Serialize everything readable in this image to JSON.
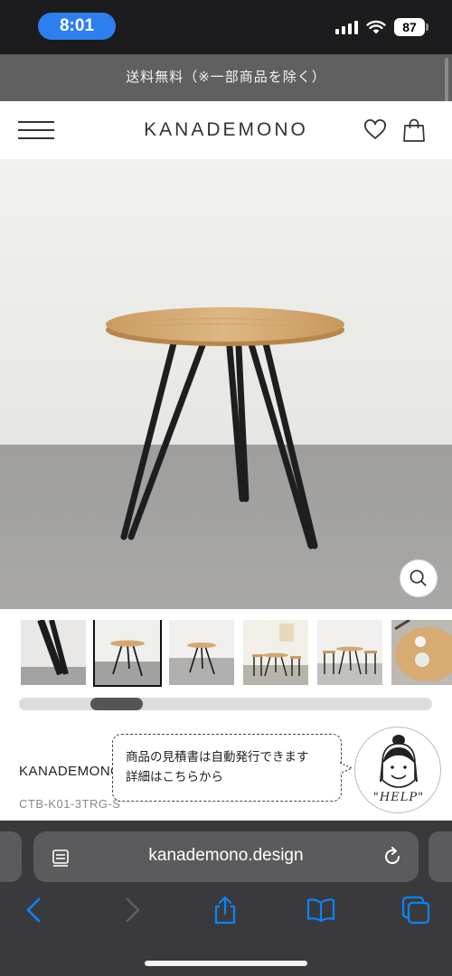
{
  "status_bar": {
    "time": "8:01",
    "battery": "87",
    "icons": [
      "signal-icon",
      "wifi-icon",
      "battery-icon"
    ]
  },
  "announcement": {
    "text": "送料無料（※一部商品を除く）"
  },
  "header": {
    "brand": "KANADEMONO",
    "icons": [
      "hamburger-menu-icon",
      "heart-icon",
      "shopping-bag-icon"
    ]
  },
  "product": {
    "brand": "KANADEMONO",
    "sku": "CTB-K01-3TRG-S",
    "thumbnails": [
      "leg-detail",
      "round-table-front",
      "round-table-small",
      "table-with-chairs",
      "table-with-chairs-2",
      "tabletop-detail"
    ],
    "selected_thumbnail_index": 1,
    "thumbnail_scroll_fraction": 0.17
  },
  "help": {
    "line1": "商品の見積書は自動発行できます",
    "line2": "詳細はこちらから",
    "avatar_label": "\"HELP\""
  },
  "browser": {
    "url": "kanademono.design",
    "icons": [
      "page-menu-icon",
      "reload-icon",
      "back-icon",
      "forward-icon",
      "share-icon",
      "bookmarks-icon",
      "tabs-icon"
    ]
  },
  "colors": {
    "accent_blue": "#2d7ff0",
    "announce_bg": "#606060",
    "safari_bg": "#3a3a3c",
    "link_blue": "#0a84ff"
  }
}
